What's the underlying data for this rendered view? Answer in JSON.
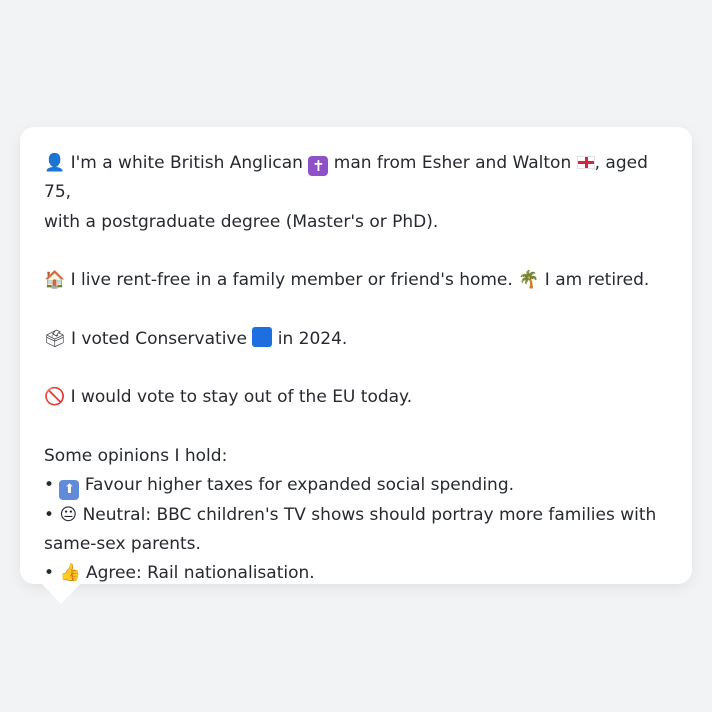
{
  "profile": {
    "identity_emoji": "👤",
    "identity_line1_a": " I'm a white British Anglican ",
    "religion_icon": "✝",
    "identity_line1_b": " man from Esher and Walton ",
    "identity_line1_c": ", aged 75,",
    "identity_line2": "with a postgraduate degree (Master's or PhD).",
    "home_emoji": "🏠",
    "housing_text": " I live rent-free in a family member or friend's home. ",
    "retire_emoji": "🌴",
    "work_text": " I am retired.",
    "ballot_emoji": "🗳",
    "vote_text_a": " I voted Conservative ",
    "vote_text_b": " in 2024.",
    "eu_emoji": "🚫",
    "eu_text": " I would vote to stay out of the EU today.",
    "opinions_heading": "Some opinions I hold:",
    "bullet": "•",
    "opinion1_icon": "⬆",
    "opinion1_text": " Favour higher taxes for expanded social spending.",
    "opinion2_emoji": "😐",
    "opinion2_text_a": " Neutral: BBC children's TV shows should portray more families with",
    "opinion2_text_b": "same-sex parents.",
    "opinion3_emoji": "👍",
    "opinion3_text": " Agree: Rail nationalisation."
  },
  "colors": {
    "background": "#f2f3f5",
    "card": "#ffffff",
    "text": "#262a30",
    "conservative_blue": "#1d6fe0",
    "england_red": "#d6243a"
  }
}
